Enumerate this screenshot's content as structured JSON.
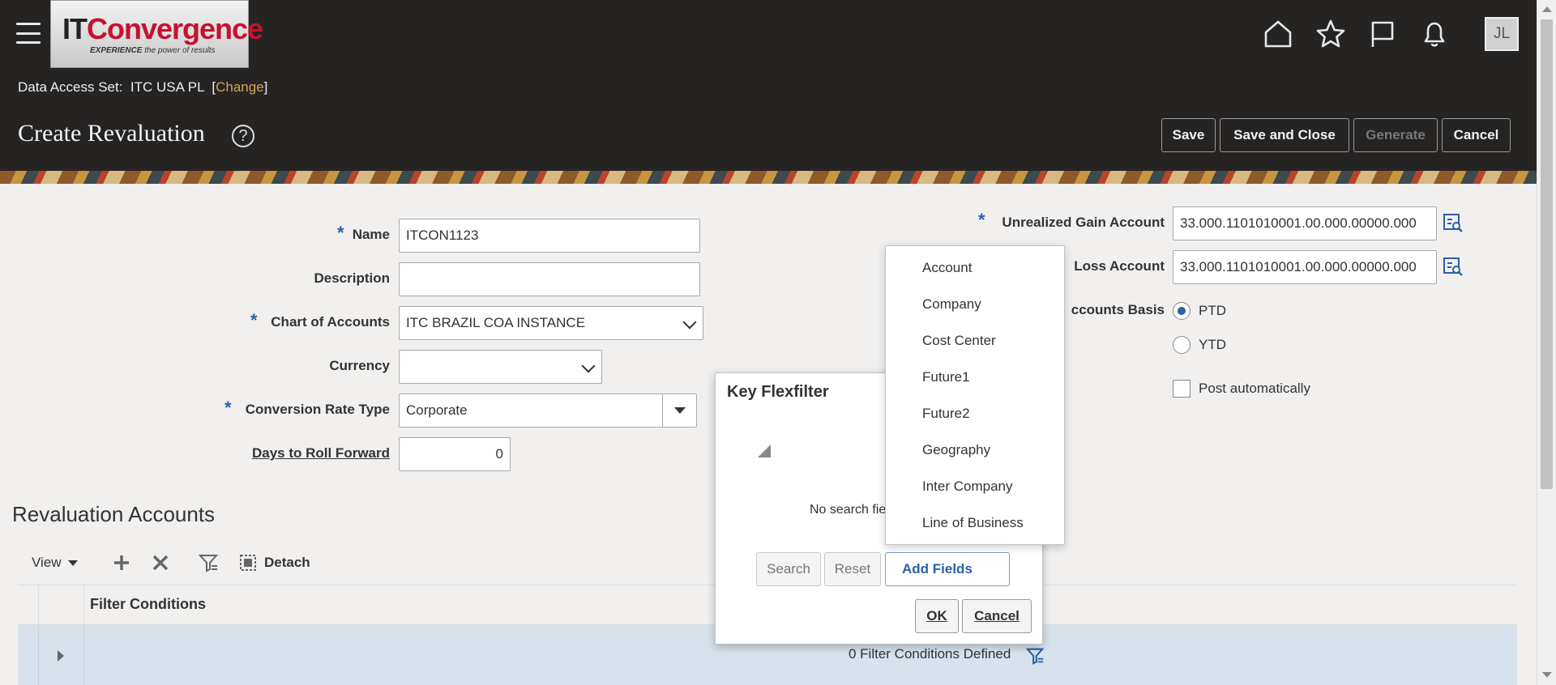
{
  "header": {
    "logo": {
      "it": "IT",
      "convergence": "Convergence",
      "tagline_bold": "EXPERIENCE",
      "tagline_rest": " the power of results"
    },
    "avatar_initials": "JL",
    "icons": [
      "home-icon",
      "favorites-star-icon",
      "flag-icon",
      "notifications-bell-icon"
    ],
    "data_access_set_label": "Data Access Set:",
    "data_access_set_value": "ITC USA PL",
    "change_link": "Change",
    "page_title": "Create Revaluation",
    "help_glyph": "?",
    "buttons": {
      "save": "Save",
      "save_close": "Save and Close",
      "generate": "Generate",
      "cancel": "Cancel"
    }
  },
  "form": {
    "name_label": "Name",
    "name_value": "ITCON1123",
    "description_label": "Description",
    "description_value": "",
    "chart_label": "Chart of Accounts",
    "chart_value": "ITC BRAZIL COA INSTANCE",
    "currency_label": "Currency",
    "currency_value": "",
    "rate_type_label": "Conversion Rate Type",
    "rate_type_value": "Corporate",
    "days_label": "Days to Roll Forward",
    "days_value": "0",
    "gain_label": "Unrealized Gain Account",
    "gain_value": "33.000.1101010001.00.000.00000.000",
    "loss_label": "Loss Account",
    "loss_value": "33.000.1101010001.00.000.00000.000",
    "basis_label": "ccounts Basis",
    "ptd": "PTD",
    "ytd": "YTD",
    "post_auto": "Post automatically",
    "required_mark": "*"
  },
  "revaluation": {
    "title": "Revaluation Accounts",
    "view": "View",
    "detach": "Detach",
    "filter_conditions_header": "Filter Conditions",
    "row_text": "0 Filter Conditions Defined"
  },
  "dialog": {
    "title": "Key Flexfilter",
    "no_fields_text": "No search fie",
    "search": "Search",
    "reset": "Reset",
    "add_fields": "Add Fields",
    "ok": "OK",
    "cancel": "Cancel"
  },
  "menu": {
    "items": [
      "Account",
      "Company",
      "Cost Center",
      "Future1",
      "Future2",
      "Geography",
      "Inter Company",
      "Line of Business"
    ]
  },
  "colors": {
    "header_bg": "#262423",
    "accent_blue": "#2a61a3",
    "link_gold": "#d0a65a",
    "selected_row": "#d7e2ec"
  }
}
